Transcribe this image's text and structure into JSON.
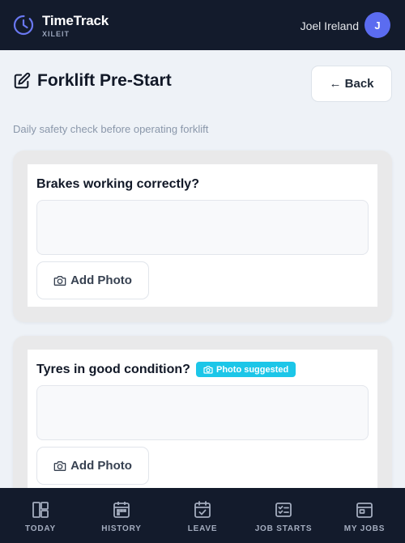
{
  "app": {
    "name": "TimeTrack",
    "subtitle": "XILEIT"
  },
  "user": {
    "name": "Joel Ireland",
    "initial": "J",
    "avatar_color": "#5b6cf0"
  },
  "page": {
    "title": "Forklift Pre-Start",
    "back_label": "← Back",
    "subtitle": "Daily safety check before operating forklift"
  },
  "questions": [
    {
      "label": "Brakes working correctly?",
      "answer": "",
      "photo_label": "Add Photo",
      "badge": null
    },
    {
      "label": "Tyres in good condition?",
      "answer": "",
      "photo_label": "Add Photo",
      "badge": "Photo suggested"
    }
  ],
  "nav": {
    "items": [
      {
        "label": "TODAY",
        "icon": "layout-icon"
      },
      {
        "label": "HISTORY",
        "icon": "calendar-icon"
      },
      {
        "label": "LEAVE",
        "icon": "calendar-check-icon"
      },
      {
        "label": "JOB STARTS",
        "icon": "checklist-icon"
      },
      {
        "label": "MY JOBS",
        "icon": "card-icon"
      }
    ]
  },
  "colors": {
    "topbar": "#131b2c",
    "background": "#eef2f7",
    "badge": "#1cc6e8",
    "accent": "#5b6cf0"
  }
}
